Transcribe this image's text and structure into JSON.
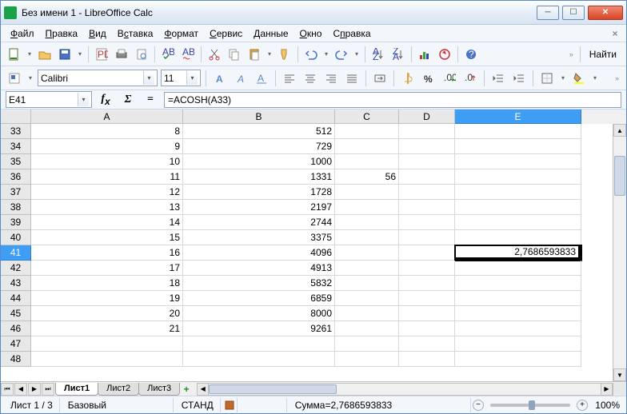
{
  "window": {
    "title": "Без имени 1 - LibreOffice Calc"
  },
  "menu": {
    "items": [
      "Файл",
      "Правка",
      "Вид",
      "Вставка",
      "Формат",
      "Сервис",
      "Данные",
      "Окно",
      "Справка"
    ],
    "underline": [
      0,
      0,
      0,
      1,
      0,
      0,
      0,
      0,
      1
    ]
  },
  "toolbar": {
    "find_label": "Найти"
  },
  "font": {
    "name": "Calibri",
    "size": "11"
  },
  "formula": {
    "cell_ref": "E41",
    "value": "=ACOSH(A33)"
  },
  "columns": [
    {
      "name": "A",
      "width": 190
    },
    {
      "name": "B",
      "width": 190
    },
    {
      "name": "C",
      "width": 80
    },
    {
      "name": "D",
      "width": 70
    },
    {
      "name": "E",
      "width": 158
    }
  ],
  "selected_col": "E",
  "selected_row": 41,
  "rows": [
    {
      "n": 33,
      "A": "8",
      "B": "512"
    },
    {
      "n": 34,
      "A": "9",
      "B": "729"
    },
    {
      "n": 35,
      "A": "10",
      "B": "1000"
    },
    {
      "n": 36,
      "A": "11",
      "B": "1331",
      "C": "56"
    },
    {
      "n": 37,
      "A": "12",
      "B": "1728"
    },
    {
      "n": 38,
      "A": "13",
      "B": "2197"
    },
    {
      "n": 39,
      "A": "14",
      "B": "2744"
    },
    {
      "n": 40,
      "A": "15",
      "B": "3375"
    },
    {
      "n": 41,
      "A": "16",
      "B": "4096",
      "E": "2,7686593833"
    },
    {
      "n": 42,
      "A": "17",
      "B": "4913"
    },
    {
      "n": 43,
      "A": "18",
      "B": "5832"
    },
    {
      "n": 44,
      "A": "19",
      "B": "6859"
    },
    {
      "n": 45,
      "A": "20",
      "B": "8000"
    },
    {
      "n": 46,
      "A": "21",
      "B": "9261"
    },
    {
      "n": 47
    },
    {
      "n": 48
    }
  ],
  "sheets": {
    "tabs": [
      "Лист1",
      "Лист2",
      "Лист3"
    ],
    "active": 0
  },
  "status": {
    "sheet_pos": "Лист 1 / 3",
    "style": "Базовый",
    "mode": "СТАНД",
    "sum": "Сумма=2,7686593833",
    "zoom": "100%"
  }
}
